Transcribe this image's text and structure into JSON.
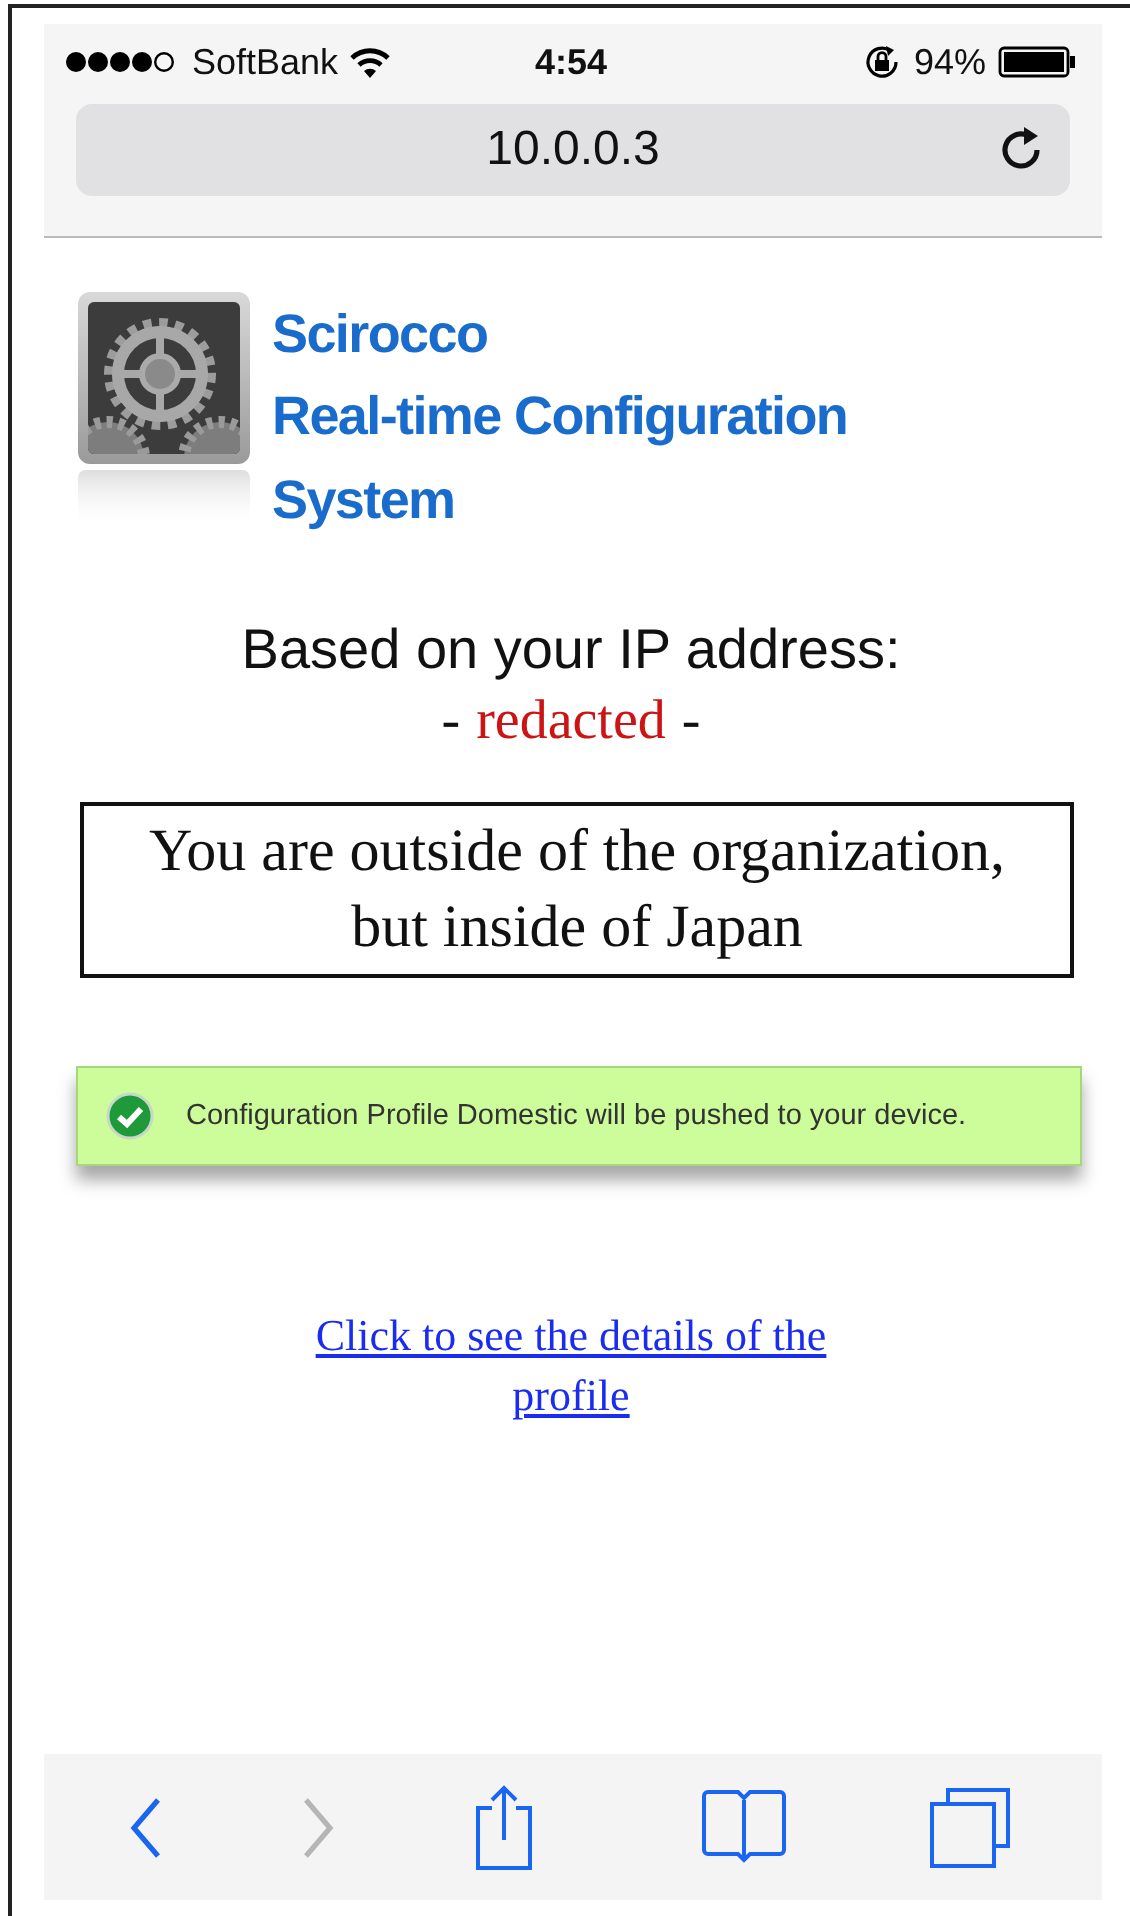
{
  "status_bar": {
    "carrier": "SoftBank",
    "time": "4:54",
    "battery": "94%"
  },
  "address_bar": {
    "url": "10.0.0.3"
  },
  "header": {
    "title_lines": [
      "Scirocco",
      "Real-time Configuration",
      "System"
    ]
  },
  "ip_heading": "Based on your IP address:",
  "ip_address": {
    "before": "-",
    "value": "redacted",
    "after": "-"
  },
  "location_message": "You are outside of the organization, but inside of Japan",
  "notice": {
    "kind": "success",
    "text": "Configuration Profile Domestic will be pushed to your device."
  },
  "details_link": "Click to see the details of the profile",
  "toolbar": [
    {
      "kind": "back",
      "disabled": false
    },
    {
      "kind": "forward",
      "disabled": true
    },
    {
      "kind": "share",
      "disabled": false
    },
    {
      "kind": "bookmarks",
      "disabled": false
    },
    {
      "kind": "tabs",
      "disabled": false
    }
  ]
}
